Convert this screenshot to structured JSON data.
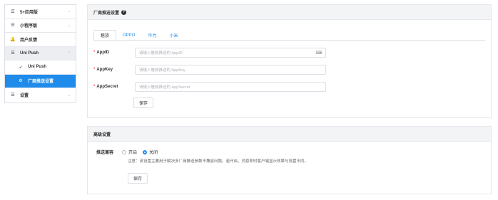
{
  "sidebar": {
    "items": [
      {
        "icon": "☰",
        "label": "5+应用版",
        "chev": "⌄"
      },
      {
        "icon": "☰",
        "label": "小程序版",
        "chev": "⌄"
      },
      {
        "icon": "🔔",
        "label": "用户反馈",
        "chev": ""
      },
      {
        "icon": "☰",
        "label": "Uni Push",
        "chev": "⌃"
      },
      {
        "icon": "➶",
        "label": "Uni Push",
        "chev": ""
      },
      {
        "icon": "⚙",
        "label": "厂商推送设置",
        "chev": ""
      },
      {
        "icon": "☰",
        "label": "设置",
        "chev": "⌄"
      }
    ]
  },
  "vendor_panel": {
    "title": "厂商推送设置",
    "help_icon": "?",
    "tabs": [
      "魅族",
      "OPPO",
      "华为",
      "小米"
    ],
    "fields": [
      {
        "label": "AppID",
        "placeholder": "请输入魅族推送的 AppID"
      },
      {
        "label": "AppKey",
        "placeholder": "请输入魅族推送的 AppKey"
      },
      {
        "label": "AppSecret",
        "placeholder": "请输入魅族推送的 AppSecret"
      }
    ],
    "keyboard_icon": "⌨",
    "save_label": "保存"
  },
  "advanced_panel": {
    "title": "高级设置",
    "push_content_label": "推送兼容",
    "options": [
      "开启",
      "关闭"
    ],
    "selected": "关闭",
    "note": "注意：该设置主要用于解决多厂商推送参数不兼容问题。若开启，消息即时客户端显示效果与设置不同。",
    "save_label": "保存"
  },
  "colors": {
    "accent": "#1f8ceb",
    "required": "#e55555"
  }
}
